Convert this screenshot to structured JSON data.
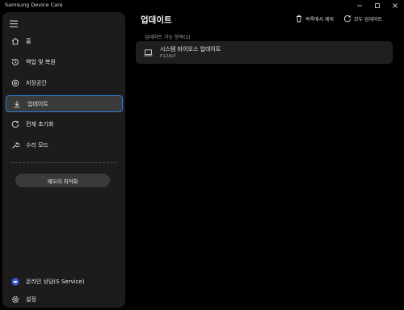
{
  "app": {
    "title": "Samsung Device Care"
  },
  "window_controls": [
    "minimize",
    "maximize",
    "close"
  ],
  "sidebar": {
    "items": [
      {
        "label": "홈",
        "icon": "home-icon"
      },
      {
        "label": "백업 및 복원",
        "icon": "history-icon"
      },
      {
        "label": "저장공간",
        "icon": "storage-icon"
      },
      {
        "label": "업데이트",
        "icon": "download-icon",
        "active": true
      },
      {
        "label": "전체 초기화",
        "icon": "reset-icon"
      },
      {
        "label": "수리 모드",
        "icon": "wrench-icon"
      }
    ],
    "memory_button": "메모리 최적화",
    "bottom": [
      {
        "label": "온라인 상담(S Service)",
        "icon": "chat-icon"
      },
      {
        "label": "설정",
        "icon": "gear-icon"
      }
    ]
  },
  "main": {
    "title": "업데이트",
    "actions": {
      "remove_label": "목록에서 제외",
      "update_all_label": "모두 업데이트"
    },
    "section_label": "업데이트 가능 항목(1)",
    "updates": [
      {
        "title": "시스템 바이오스 업데이트",
        "subtitle": "P12ALY"
      }
    ]
  },
  "colors": {
    "background": "#000000",
    "sidebar": "#1c1c1c",
    "active_border": "#2f7de1",
    "card": "#1f1f1f",
    "chat_icon": "#3c5bd6"
  }
}
